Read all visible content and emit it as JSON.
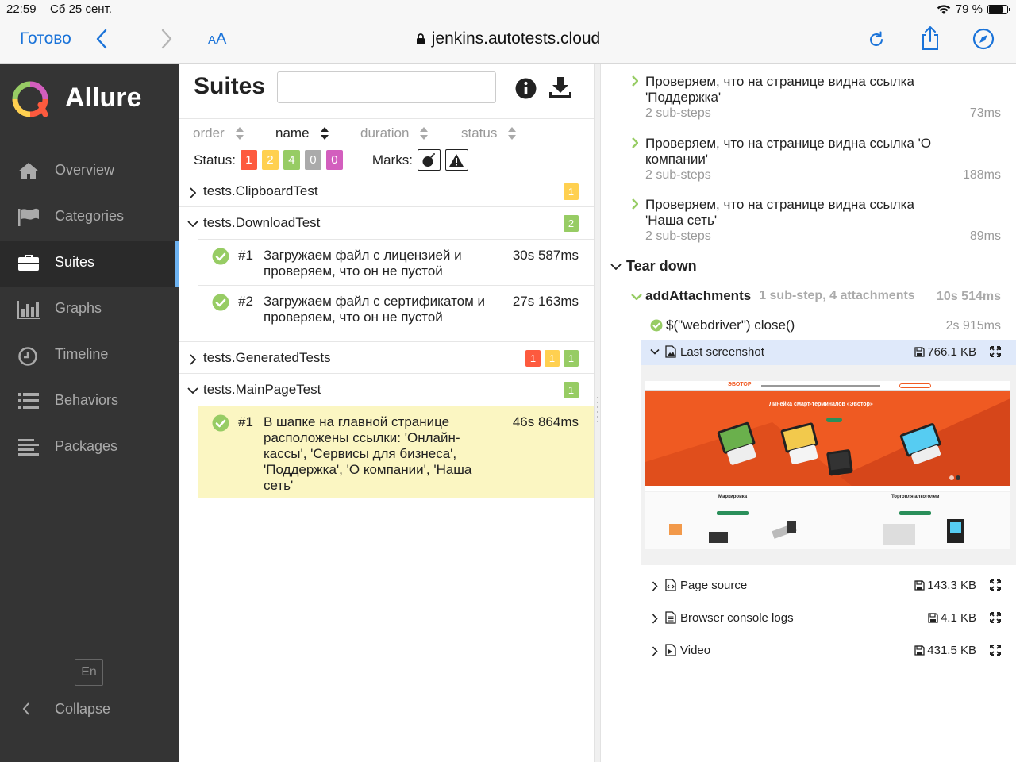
{
  "status_bar": {
    "time": "22:59",
    "date": "Сб 25 сент.",
    "battery": "79 %",
    "battery_level": 0.79
  },
  "browser": {
    "done_label": "Готово",
    "aa_label_small": "A",
    "aa_label_big": "A",
    "url": "jenkins.autotests.cloud"
  },
  "sidebar": {
    "brand": "Allure",
    "items": [
      {
        "label": "Overview",
        "icon": "home-icon"
      },
      {
        "label": "Categories",
        "icon": "flag-icon"
      },
      {
        "label": "Suites",
        "icon": "briefcase-icon"
      },
      {
        "label": "Graphs",
        "icon": "bar-chart-icon"
      },
      {
        "label": "Timeline",
        "icon": "clock-icon"
      },
      {
        "label": "Behaviors",
        "icon": "list-icon"
      },
      {
        "label": "Packages",
        "icon": "align-left-icon"
      }
    ],
    "active_item": "Suites",
    "language": "En",
    "collapse_label": "Collapse"
  },
  "suites": {
    "title": "Suites",
    "search_value": "",
    "sort": [
      {
        "label": "order"
      },
      {
        "label": "name"
      },
      {
        "label": "duration"
      },
      {
        "label": "status"
      }
    ],
    "status_label": "Status:",
    "status_counts": [
      "1",
      "2",
      "4",
      "0",
      "0"
    ],
    "status_colors": [
      "#fd5a3e",
      "#ffd050",
      "#97cc64",
      "#aaaaaa",
      "#d35ebe"
    ],
    "marks_label": "Marks:",
    "groups": [
      {
        "name": "tests.ClipboardTest",
        "badges": [
          "1"
        ],
        "badge_colors": [
          "#ffd050"
        ],
        "expanded": false
      },
      {
        "name": "tests.DownloadTest",
        "badges": [
          "2"
        ],
        "badge_colors": [
          "#97cc64"
        ],
        "expanded": true,
        "tests": [
          {
            "num": "#1",
            "name": "Загружаем файл с лицензией и проверяем, что он не пустой",
            "duration": "30s 587ms"
          },
          {
            "num": "#2",
            "name": "Загружаем файл с сертификатом и проверяем, что он не пустой",
            "duration": "27s 163ms"
          }
        ]
      },
      {
        "name": "tests.GeneratedTests",
        "badges": [
          "1",
          "1",
          "1"
        ],
        "badge_colors": [
          "#fd5a3e",
          "#ffd050",
          "#97cc64"
        ],
        "expanded": false
      },
      {
        "name": "tests.MainPageTest",
        "badges": [
          "1"
        ],
        "badge_colors": [
          "#97cc64"
        ],
        "expanded": true,
        "tests": [
          {
            "num": "#1",
            "name": "В шапке на главной странице расположены ссылки: 'Онлайн-кассы', 'Сервисы для бизнеса', 'Поддержка', 'О компании', 'Наша сеть'",
            "duration": "46s 864ms"
          }
        ]
      }
    ]
  },
  "details": {
    "steps": [
      {
        "title": "Проверяем, что на странице видна ссылка 'Поддержка'",
        "sub": "2 sub-steps",
        "duration": "73ms"
      },
      {
        "title": "Проверяем, что на странице видна ссылка 'О компании'",
        "sub": "2 sub-steps",
        "duration": "188ms"
      },
      {
        "title": "Проверяем, что на странице видна ссылка 'Наша сеть'",
        "sub": "2 sub-steps",
        "duration": "89ms"
      }
    ],
    "teardown_title": "Tear down",
    "add_attachments": {
      "name": "addAttachments",
      "meta": "1 sub-step, 4 attachments",
      "duration": "10s 514ms"
    },
    "close_step": {
      "name": "$(\"webdriver\") close()",
      "duration": "2s 915ms"
    },
    "attachments": [
      {
        "name": "Last screenshot",
        "size": "766.1 KB",
        "icon": "image-icon",
        "expanded": true
      },
      {
        "name": "Page source",
        "size": "143.3 KB",
        "icon": "code-file-icon",
        "expanded": false
      },
      {
        "name": "Browser console logs",
        "size": "4.1 KB",
        "icon": "text-file-icon",
        "expanded": false
      },
      {
        "name": "Video",
        "size": "431.5 KB",
        "icon": "video-file-icon",
        "expanded": false
      }
    ],
    "screenshot": {
      "logo": "ЭВОТОР",
      "hero_title": "Линейка смарт-терминалов «Эвотор»",
      "card1_title": "Маркировка",
      "card2_title": "Торговля алкоголем"
    }
  }
}
